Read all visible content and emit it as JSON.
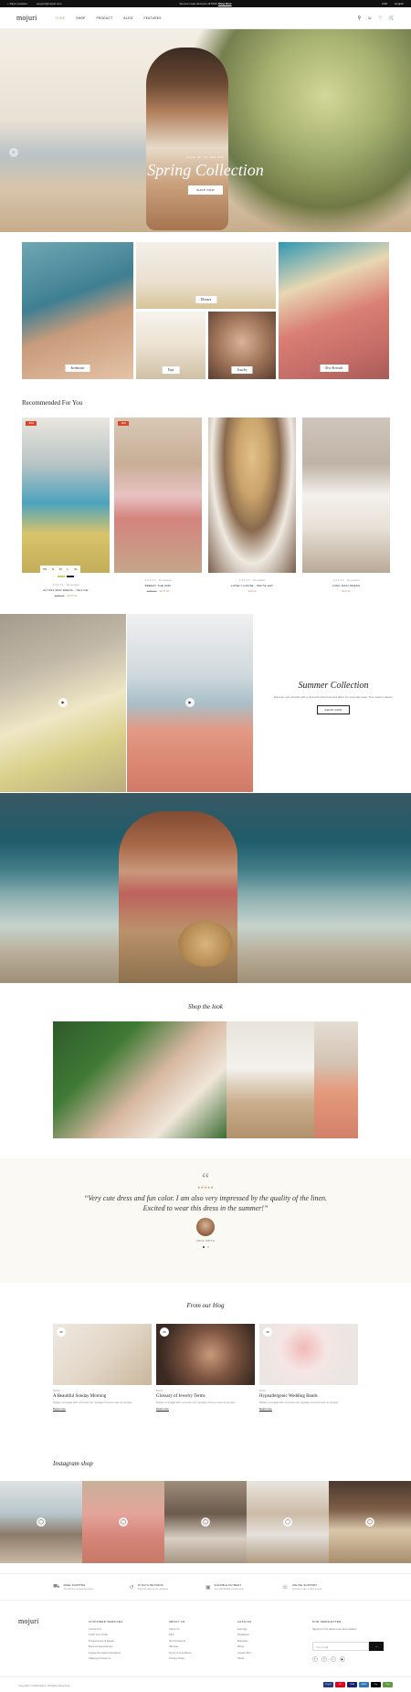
{
  "topbar": {
    "phone": "+ Store Location",
    "email": "support@mojuri.com",
    "promo": "Summer sale discount off 50%!",
    "promo_link": "Shop Now",
    "currency": "USD",
    "language": "English"
  },
  "header": {
    "logo": "mojuri",
    "nav": [
      "HOME",
      "SHOP",
      "PRODUCT",
      "BLOG",
      "FEATURES"
    ],
    "cart_count": "0"
  },
  "hero": {
    "kicker": "SALE UP TO 40% OFF",
    "title": "Spring Collection",
    "button": "SHOP NOW"
  },
  "categories": [
    "Swimwear",
    "Dresses",
    "Tops",
    "Jewelry",
    "New Arrivals"
  ],
  "recommended": {
    "title": "Recommended For You",
    "products": [
      {
        "badge": "-30%",
        "name": "ALYSSA MIDI DRESS - YELLOW",
        "old_price": "$250.00",
        "price": "$175.00",
        "reviews": "No reviews"
      },
      {
        "badge": "-30%",
        "name": "BREEZY THE MIDI",
        "old_price": "$250.00",
        "price": "$175.00",
        "reviews": "No reviews"
      },
      {
        "badge": "",
        "name": "LOVELY HOUSE - WHITE HAT",
        "old_price": "",
        "price": "$45.00",
        "reviews": "No reviews"
      },
      {
        "badge": "",
        "name": "LONG MAXI DRESS",
        "old_price": "",
        "price": "$60.00",
        "reviews": "No reviews"
      }
    ],
    "sizes": [
      "XS",
      "S",
      "M",
      "L",
      "XL"
    ]
  },
  "summer": {
    "title": "Summer Collection",
    "desc": "Discover new arrivals with a ultra-soft dress blended fabric for everyday wear. The modern classic.",
    "button": "SHOP NOW"
  },
  "shop_the_look": {
    "title": "Shop the look"
  },
  "testimonial": {
    "quote_mark": "“",
    "stars": "★★★★★",
    "text": "“Very cute dress and fun color. I am also very impressed by the quality of the linen. Excited to wear this dress in the summer!”",
    "author": "ANNA SMITH"
  },
  "blog": {
    "title": "From our blog",
    "posts": [
      {
        "date": "08",
        "cat": "BLOG",
        "title": "A Beautiful Sunday Morning",
        "excerpt": "Nullam et feugiat felis, at luctus nisi. Quisque rhoncus ante ac semper.",
        "more": "Read more"
      },
      {
        "date": "08",
        "cat": "BLOG",
        "title": "Glossary of Jewelry Terms",
        "excerpt": "Nullam et feugiat felis, at luctus nisi. Quisque rhoncus ante ac semper.",
        "more": "Read more"
      },
      {
        "date": "08",
        "cat": "BLOG",
        "title": "Hypoallergenic Wedding Bands",
        "excerpt": "Nullam et feugiat felis, at luctus nisi. Quisque rhoncus ante ac semper.",
        "more": "Read more"
      }
    ]
  },
  "instagram": {
    "title": "Instagram shop"
  },
  "features": [
    {
      "title": "FREE SHIPPING",
      "desc": "You will love at great low prices"
    },
    {
      "title": "15 DAYS RETURNS",
      "desc": "Within 15 days for an exchange"
    },
    {
      "title": "FLEXIBLE PAYMENT",
      "desc": "Pay with Multiple Credit Cards"
    },
    {
      "title": "ONLINE SUPPORT",
      "desc": "24 hours a day, 7 days a week"
    }
  ],
  "footer": {
    "logo": "mojuri",
    "cols": [
      {
        "title": "CUSTOMER SERVICES",
        "items": [
          "Contact Us",
          "Track Your Order",
          "Product Care & Repair",
          "Book an Appointment",
          "Frequently Asked Questions",
          "Shipping & Returns"
        ]
      },
      {
        "title": "ABOUT US",
        "items": [
          "About Us",
          "FAQ",
          "Our Producers",
          "Sitemap",
          "Terms & Conditions",
          "Privacy Policy"
        ]
      },
      {
        "title": "CATALOG",
        "items": [
          "Earrings",
          "Necklaces",
          "Bracelets",
          "Rings",
          "Jewelry Box",
          "Studs"
        ]
      }
    ],
    "newsletter": {
      "title": "OUR NEWSLETTER",
      "desc": "Signup for the latest news and updates",
      "placeholder": "Your email",
      "button": "→"
    },
    "copyright": "Copyright © 2023 Mojuri. All Rights Reserved.",
    "payments": [
      "PayPal",
      "MC",
      "VISA",
      "AMEX",
      "Pay",
      "Pay"
    ]
  }
}
